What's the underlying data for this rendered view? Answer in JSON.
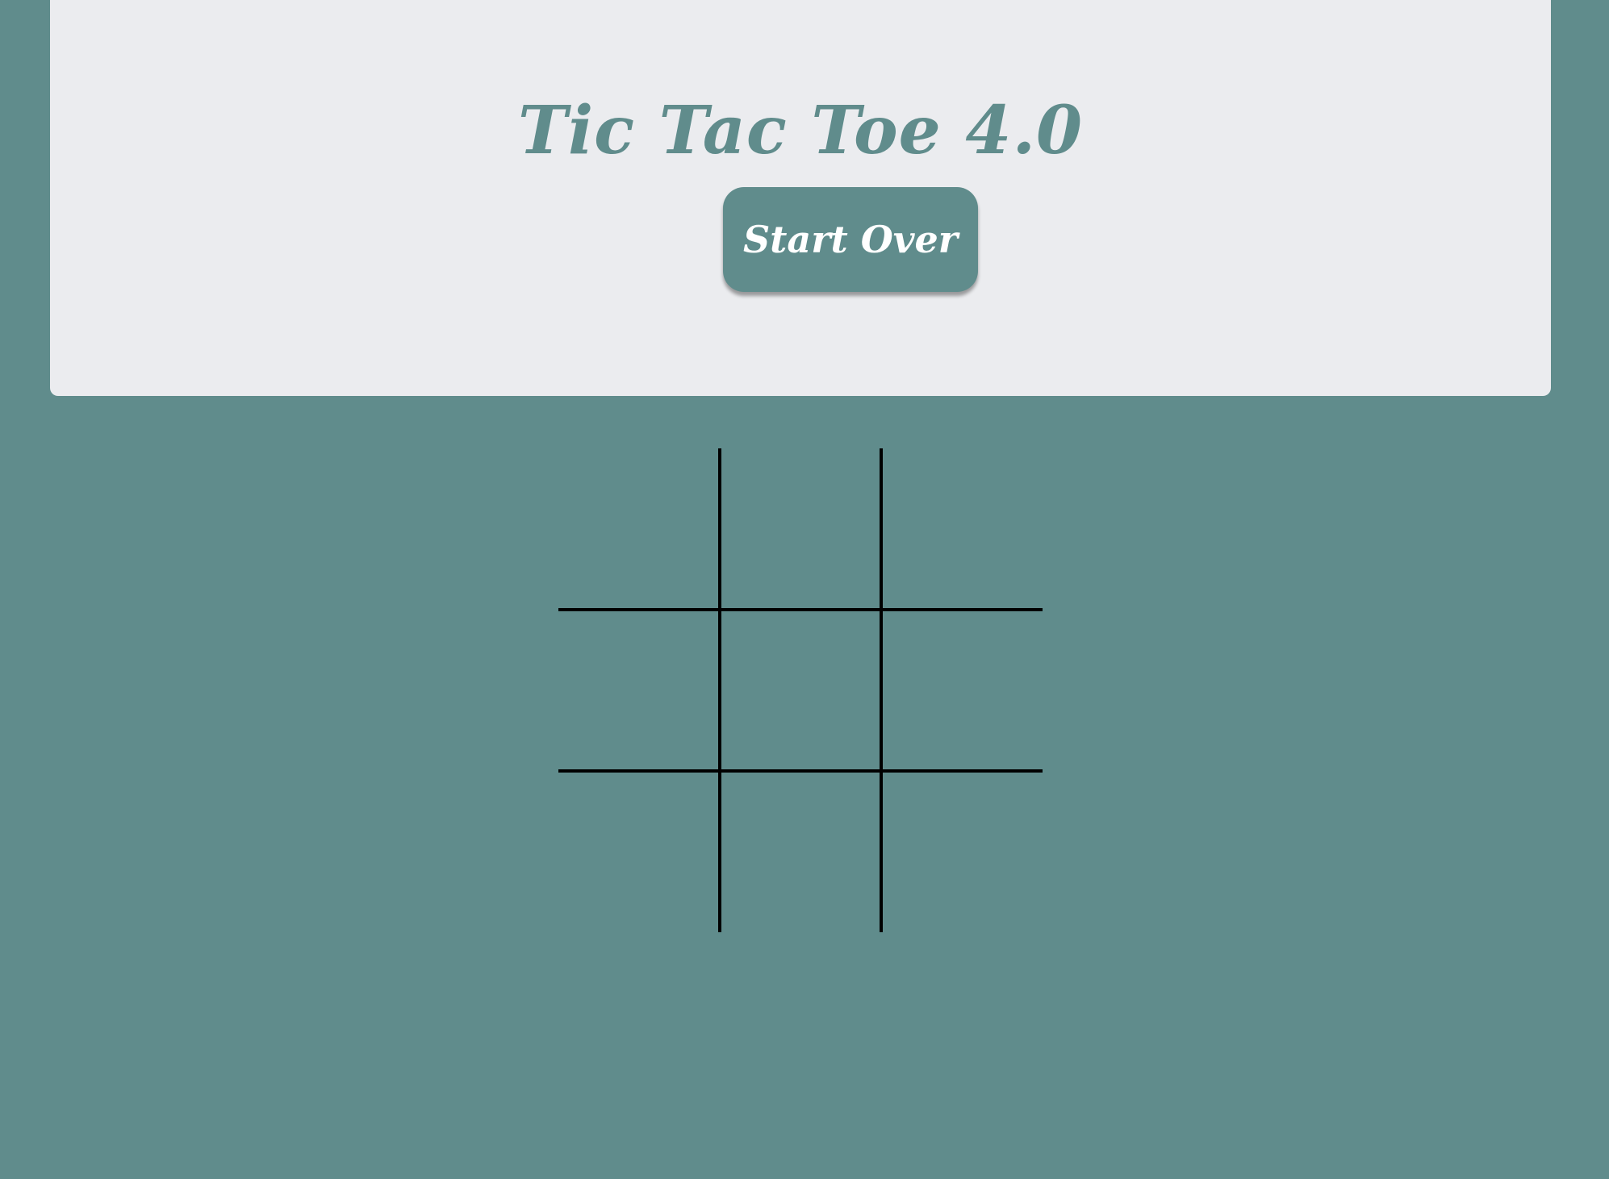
{
  "header": {
    "title": "Tic Tac Toe 4.0",
    "start_over_label": "Start Over"
  },
  "board": {
    "cells": [
      "",
      "",
      "",
      "",
      "",
      "",
      "",
      "",
      ""
    ]
  },
  "colors": {
    "background": "#608c8c",
    "header_background": "#ebecef",
    "accent": "#608c8c",
    "grid_lines": "#000000"
  }
}
